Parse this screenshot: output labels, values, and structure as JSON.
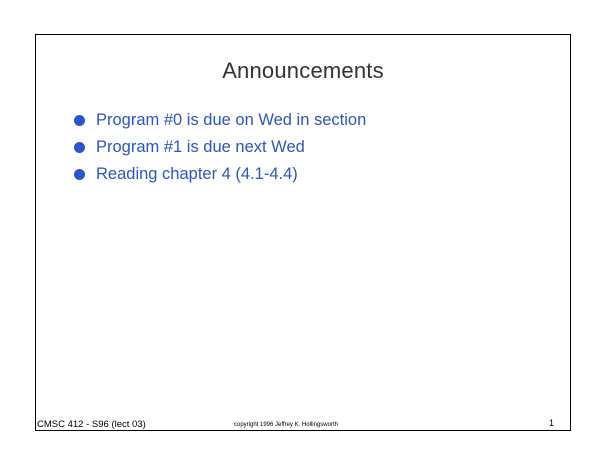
{
  "slide": {
    "title": "Announcements",
    "bullets": [
      "Program #0 is due on Wed in section",
      "Program #1 is due next Wed",
      "Reading chapter 4 (4.1-4.4)"
    ],
    "bullet_color": "#2a55cc",
    "footer": {
      "course": "CMSC 412 - S96  (lect 03)",
      "copyright": "copyright 1996 Jeffrey K. Hollingsworth",
      "page_number": "1"
    }
  }
}
